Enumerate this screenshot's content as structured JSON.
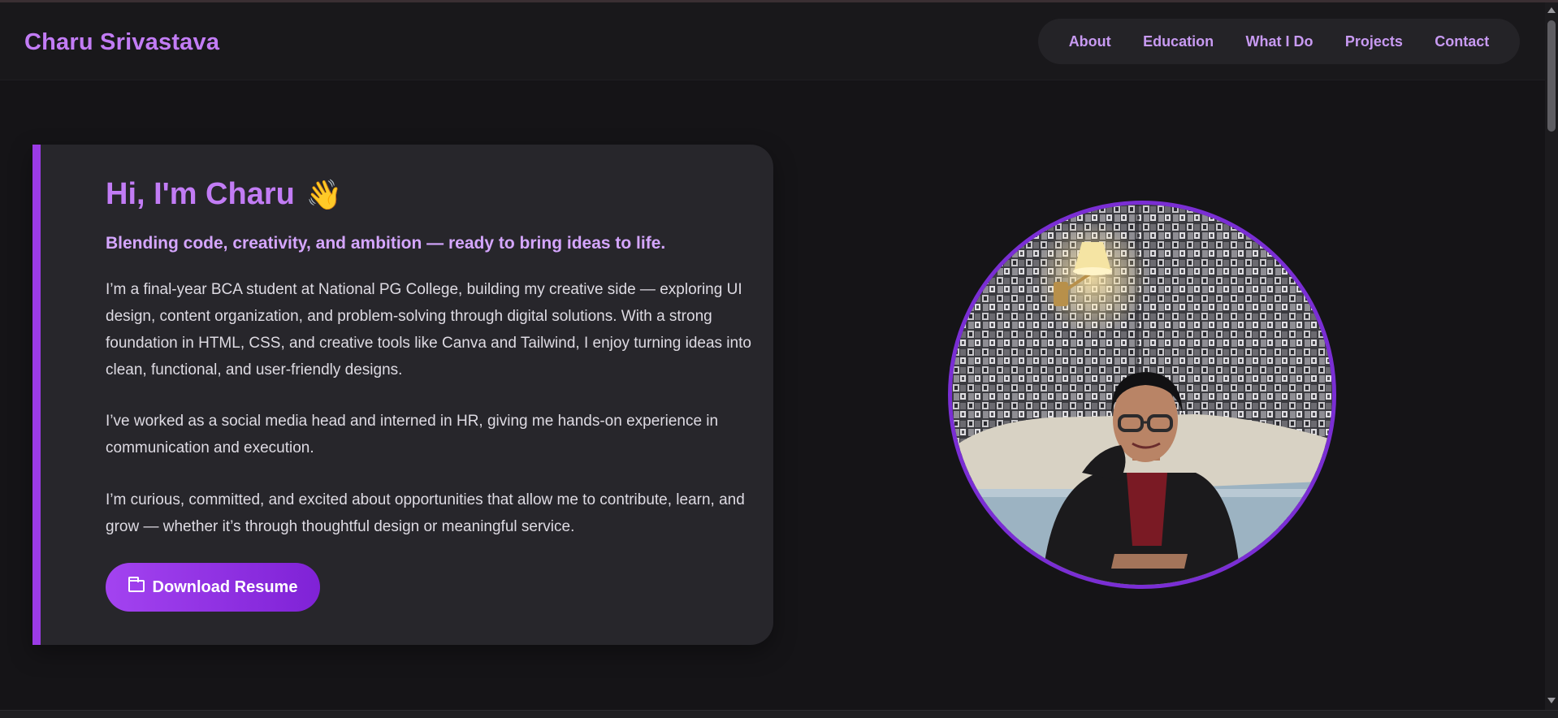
{
  "header": {
    "brand": "Charu Srivastava",
    "nav": [
      "About",
      "Education",
      "What I Do",
      "Projects",
      "Contact"
    ]
  },
  "hero": {
    "greeting": "Hi, I'm Charu",
    "wave_icon": "👋",
    "tagline": "Blending code, creativity, and ambition — ready to bring ideas to life.",
    "paragraphs": [
      "I’m a final-year BCA student at National PG College, building my creative side — exploring UI design, content organization, and problem-solving through digital solutions. With a strong foundation in HTML, CSS, and creative tools like Canva and Tailwind, I enjoy turning ideas into clean, functional, and user-friendly designs.",
      "I’ve worked as a social media head and interned in HR, giving me hands-on experience in communication and execution.",
      "I’m curious, committed, and excited about opportunities that allow me to contribute, learn, and grow — whether it’s through thoughtful design or meaningful service."
    ],
    "button_label": "Download Resume",
    "button_icon": "folder-icon"
  },
  "photo": {
    "subject": "profile-photo"
  },
  "colors": {
    "accent": "#c27cf5",
    "accent_dark": "#7f22d6",
    "card_bg": "#27262b",
    "page_bg": "#151417"
  }
}
